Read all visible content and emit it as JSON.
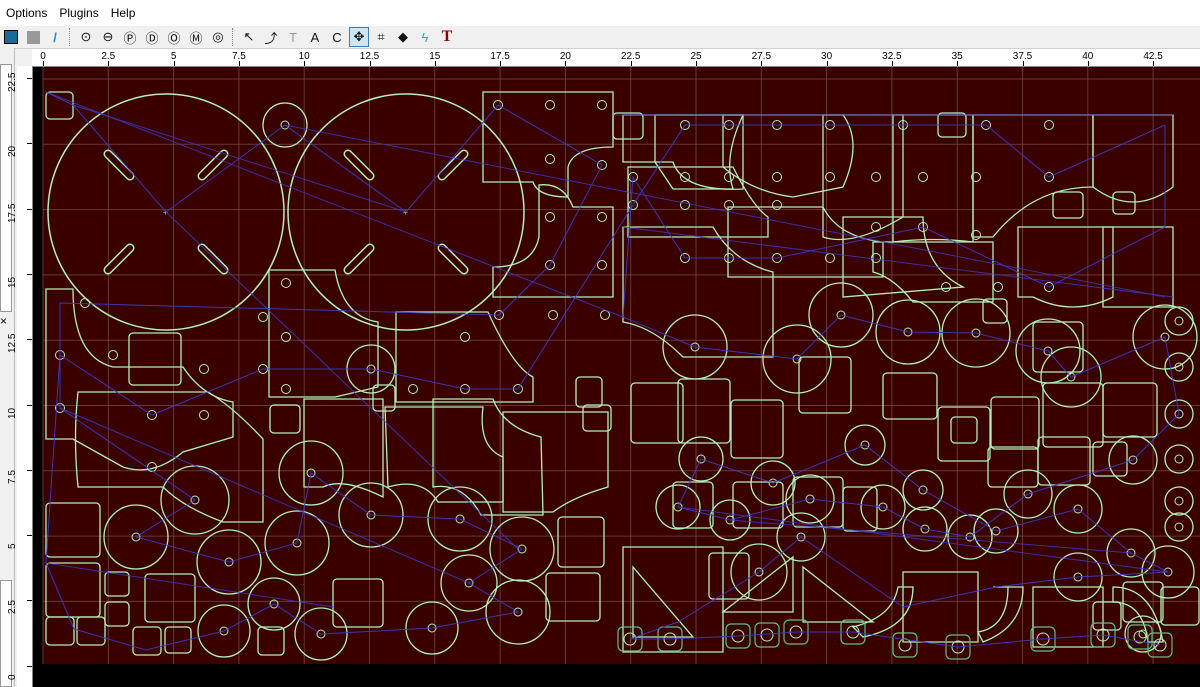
{
  "menu": {
    "items": [
      "Options",
      "Plugins",
      "Help"
    ]
  },
  "toolbar": {
    "groups": [
      [
        "layer-icon",
        "gray-square-icon",
        "pen-icon"
      ],
      [
        "tool-circle-down-icon",
        "tool-circle-minus-icon",
        "tool-circle-p-icon",
        "tool-circle-d-icon",
        "tool-circle-o-icon",
        "tool-circle-m-icon",
        "tool-circle-split-icon"
      ],
      [
        "select-arrow-icon",
        "select-s-icon",
        "select-t-icon",
        "select-a-icon",
        "select-c-icon",
        "move-cross-icon",
        "crop-icon",
        "diamond-fill-icon",
        "lightning-icon",
        "text-t-icon"
      ]
    ]
  },
  "colors": {
    "workspace": "#3a0000",
    "part_outline": "#b4f0b4",
    "part_outline_dim": "#5fbf7f",
    "toolpath": "#3c3cc8",
    "grid": "#7a5050"
  },
  "ruler": {
    "x_labels": [
      "0",
      "2.5",
      "5",
      "7.5",
      "10",
      "12.5",
      "15",
      "17.5",
      "20",
      "22.5",
      "25",
      "27.5",
      "30",
      "32.5",
      "35",
      "37.5",
      "40",
      "42.5"
    ],
    "y_labels": [
      "22.5",
      "20",
      "17.5",
      "15",
      "12.5",
      "10",
      "7.5",
      "5",
      "2.5",
      "0"
    ]
  },
  "left_panel": {
    "close_label": "×"
  }
}
